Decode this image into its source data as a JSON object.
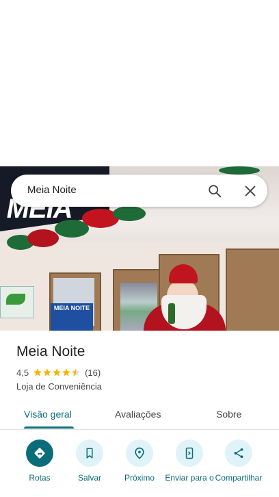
{
  "search": {
    "query": "Meia Noite"
  },
  "photo": {
    "sign_text": "MEIA",
    "banner_text": "MEIA NOITE"
  },
  "place": {
    "name": "Meia Noite",
    "rating": "4,5",
    "rating_value": 4.5,
    "review_count": "(16)",
    "category": "Loja de Conveniência"
  },
  "tabs": [
    {
      "label": "Visão geral",
      "active": true
    },
    {
      "label": "Avaliações",
      "active": false
    },
    {
      "label": "Sobre",
      "active": false
    }
  ],
  "actions": [
    {
      "label": "Rotas",
      "icon": "directions-icon"
    },
    {
      "label": "Salvar",
      "icon": "bookmark-icon"
    },
    {
      "label": "Próximo",
      "icon": "nearby-icon"
    },
    {
      "label": "Enviar para o",
      "icon": "send-to-phone-icon"
    },
    {
      "label": "Compartilhar",
      "icon": "share-icon"
    }
  ],
  "colors": {
    "accent": "#0b6c7a",
    "action_bg": "#dff3f8",
    "star": "#f5b400"
  }
}
